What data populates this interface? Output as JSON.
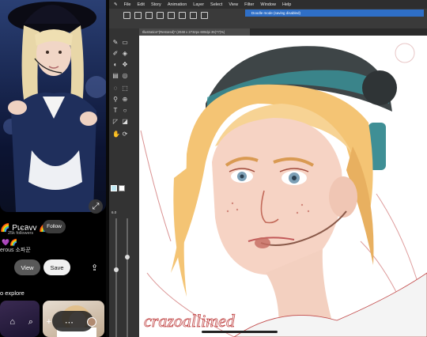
{
  "pinterest": {
    "creator_name": "🌈 Pเєลvv 🌈",
    "followers": "25k followers",
    "follow_label": "Follow",
    "emoji": "💜🌈",
    "description": "erous 소파꾼",
    "view_label": "View",
    "save_label": "Save",
    "more_to_explore": "o explore",
    "nav_icons": [
      "home-icon",
      "search-icon",
      "plus-icon",
      "messages-icon",
      "profile-avatar"
    ]
  },
  "csp": {
    "menu": [
      "File",
      "Edit",
      "Story",
      "Animation",
      "Layer",
      "Select",
      "View",
      "Filter",
      "Window",
      "Help"
    ],
    "doodle_mode": "Doodle mode (saving disabled)",
    "document_tab": "Illustration*(Restored)* (2048 x 2732px 600dpi 35(77)%)",
    "brush_size": "6.0",
    "colors": {
      "main": "#bfe9f4",
      "sub": "#ffffff",
      "accent": "#2f6fc7"
    }
  },
  "watermark": "crazoallimed"
}
